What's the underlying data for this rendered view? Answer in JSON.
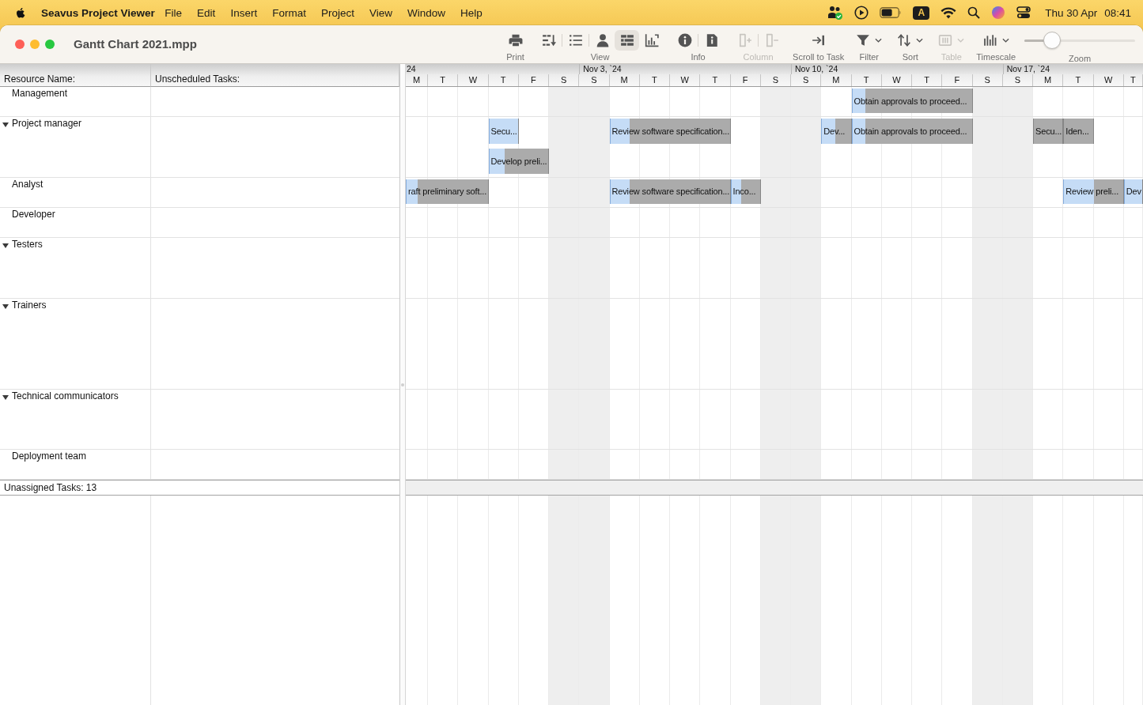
{
  "menu_bar": {
    "app_name": "Seavus Project Viewer",
    "menus": [
      "File",
      "Edit",
      "Insert",
      "Format",
      "Project",
      "View",
      "Window",
      "Help"
    ],
    "input_source": "A",
    "clock": {
      "date": "Thu 30 Apr",
      "time": "08:41"
    }
  },
  "window": {
    "title": "Gantt Chart 2021.mpp"
  },
  "toolbar": {
    "items": [
      {
        "label": "Print",
        "disabled": false,
        "segments": [
          [
            {
              "kind": "print",
              "selected": false,
              "dropdown": false
            }
          ]
        ]
      },
      {
        "label": "View",
        "disabled": false,
        "segments": [
          [
            {
              "kind": "rows",
              "selected": false,
              "dropdown": false
            }
          ],
          [
            {
              "kind": "list",
              "selected": false,
              "dropdown": false
            }
          ],
          [
            {
              "kind": "person",
              "selected": false,
              "dropdown": false
            },
            {
              "kind": "gantt",
              "selected": true,
              "dropdown": false
            },
            {
              "kind": "chart",
              "selected": false,
              "dropdown": false
            }
          ]
        ]
      },
      {
        "label": "Info",
        "disabled": false,
        "segments": [
          [
            {
              "kind": "info",
              "selected": false,
              "dropdown": false
            }
          ],
          [
            {
              "kind": "doc_info",
              "selected": false,
              "dropdown": false
            }
          ]
        ]
      },
      {
        "label": "Column",
        "disabled": true,
        "segments": [
          [
            {
              "kind": "add_column",
              "selected": false,
              "dropdown": false
            }
          ],
          [
            {
              "kind": "remove_column",
              "selected": false,
              "dropdown": false
            }
          ]
        ]
      },
      {
        "label": "Scroll to Task",
        "disabled": false,
        "segments": [
          [
            {
              "kind": "scroll_to",
              "selected": false,
              "dropdown": false
            }
          ]
        ]
      },
      {
        "label": "Filter",
        "disabled": false,
        "segments": [
          [
            {
              "kind": "filter",
              "selected": false,
              "dropdown": true
            }
          ]
        ]
      },
      {
        "label": "Sort",
        "disabled": false,
        "segments": [
          [
            {
              "kind": "sort",
              "selected": false,
              "dropdown": true
            }
          ]
        ]
      },
      {
        "label": "Table",
        "disabled": true,
        "segments": [
          [
            {
              "kind": "table",
              "selected": false,
              "dropdown": true
            }
          ]
        ]
      },
      {
        "label": "Timescale",
        "disabled": false,
        "segments": [
          [
            {
              "kind": "timescale",
              "selected": false,
              "dropdown": true
            }
          ]
        ]
      }
    ],
    "zoom": {
      "label": "Zoom",
      "level": 0.2
    }
  },
  "resource_table": {
    "columns": [
      "Resource Name:",
      "Unscheduled Tasks:"
    ],
    "rows": [
      {
        "name": "Management",
        "lanes": [
          {
            "kind": "bars",
            "slots": [
              {
                "kind": "gap"
              },
              {
                "kind": "gap"
              },
              {
                "kind": "gap"
              },
              {
                "kind": "gap"
              },
              {
                "kind": "gap"
              },
              {
                "kind": "gap"
              },
              {
                "kind": "gap"
              },
              {
                "kind": "gap"
              },
              {
                "kind": "gap"
              },
              {
                "kind": "gap"
              },
              {
                "kind": "gap"
              },
              {
                "kind": "gap"
              },
              {
                "kind": "gap"
              },
              {
                "kind": "gap"
              },
              {
                "kind": "gap"
              },
              {
                "kind": "bar",
                "label": "Obtain approvals to proceed...",
                "level": 0.11
              },
              {
                "kind": "more"
              },
              {
                "kind": "more"
              },
              {
                "kind": "more"
              },
              {
                "kind": "gap"
              },
              {
                "kind": "gap"
              },
              {
                "kind": "gap"
              },
              {
                "kind": "gap"
              },
              {
                "kind": "gap"
              },
              {
                "kind": "gap"
              }
            ]
          }
        ]
      },
      {
        "name": "Project manager",
        "expanded": true,
        "lanes": [
          {
            "kind": "bars",
            "slots": [
              {
                "kind": "gap"
              },
              {
                "kind": "gap"
              },
              {
                "kind": "gap"
              },
              {
                "kind": "bar",
                "label": "Secu...",
                "level": 1
              },
              {
                "kind": "gap"
              },
              {
                "kind": "gap"
              },
              {
                "kind": "gap"
              },
              {
                "kind": "bar",
                "label": "Review software specification...",
                "level": 0.16
              },
              {
                "kind": "more"
              },
              {
                "kind": "more"
              },
              {
                "kind": "more"
              },
              {
                "kind": "gap"
              },
              {
                "kind": "gap"
              },
              {
                "kind": "gap"
              },
              {
                "kind": "bar",
                "label": "Dev...",
                "level": 0.47
              },
              {
                "kind": "bar",
                "label": "Obtain approvals to proceed...",
                "level": 0.11
              },
              {
                "kind": "more"
              },
              {
                "kind": "more"
              },
              {
                "kind": "more"
              },
              {
                "kind": "gap"
              },
              {
                "kind": "gap"
              },
              {
                "kind": "bar",
                "label": "Secu..."
              },
              {
                "kind": "bar",
                "label": "Iden..."
              },
              {
                "kind": "gap"
              },
              {
                "kind": "gap"
              }
            ]
          },
          {
            "kind": "bars",
            "slots": [
              {
                "kind": "gap"
              },
              {
                "kind": "gap"
              },
              {
                "kind": "gap"
              },
              {
                "kind": "bar",
                "label": "Develop preli...",
                "level": 0.26
              },
              {
                "kind": "more"
              },
              {
                "kind": "gap"
              },
              {
                "kind": "gap"
              },
              {
                "kind": "gap"
              },
              {
                "kind": "gap"
              },
              {
                "kind": "gap"
              },
              {
                "kind": "gap"
              },
              {
                "kind": "gap"
              },
              {
                "kind": "gap"
              },
              {
                "kind": "gap"
              },
              {
                "kind": "gap"
              },
              {
                "kind": "gap"
              },
              {
                "kind": "gap"
              },
              {
                "kind": "gap"
              },
              {
                "kind": "gap"
              },
              {
                "kind": "gap"
              },
              {
                "kind": "gap"
              },
              {
                "kind": "gap"
              },
              {
                "kind": "gap"
              },
              {
                "kind": "gap"
              },
              {
                "kind": "gap"
              }
            ]
          }
        ]
      },
      {
        "name": "Analyst",
        "lanes": [
          {
            "kind": "bars",
            "slots": [
              {
                "kind": "bar",
                "label": "raft preliminary soft...",
                "level": 0.14
              },
              {
                "kind": "more"
              },
              {
                "kind": "more"
              },
              {
                "kind": "gap"
              },
              {
                "kind": "gap"
              },
              {
                "kind": "gap"
              },
              {
                "kind": "gap"
              },
              {
                "kind": "bar",
                "label": "Review software specification...",
                "level": 0.16
              },
              {
                "kind": "more"
              },
              {
                "kind": "more"
              },
              {
                "kind": "more"
              },
              {
                "kind": "bar",
                "label": "Inco...",
                "level": 0.34
              },
              {
                "kind": "gap"
              },
              {
                "kind": "gap"
              },
              {
                "kind": "gap"
              },
              {
                "kind": "gap"
              },
              {
                "kind": "gap"
              },
              {
                "kind": "gap"
              },
              {
                "kind": "gap"
              },
              {
                "kind": "gap"
              },
              {
                "kind": "gap"
              },
              {
                "kind": "gap"
              },
              {
                "kind": "bar",
                "label": "Review preli...",
                "level": 0.5
              },
              {
                "kind": "more"
              },
              {
                "kind": "bar",
                "label": "Dev",
                "level": 1
              }
            ]
          }
        ]
      },
      {
        "name": "Developer",
        "lanes": [
          {
            "kind": "empty"
          }
        ]
      },
      {
        "name": "Testers",
        "expanded": true,
        "lanes": [
          {
            "kind": "empty"
          },
          {
            "kind": "empty"
          }
        ]
      },
      {
        "name": "Trainers",
        "expanded": true,
        "lanes": [
          {
            "kind": "empty"
          },
          {
            "kind": "empty"
          },
          {
            "kind": "empty"
          }
        ]
      },
      {
        "name": "Technical communicators",
        "expanded": true,
        "lanes": [
          {
            "kind": "empty"
          },
          {
            "kind": "empty"
          }
        ]
      },
      {
        "name": "Deployment team",
        "lanes": [
          {
            "kind": "empty"
          }
        ]
      }
    ],
    "footer": "Unassigned Tasks: 13"
  },
  "gantt": {
    "weeks": [
      {
        "label": "24",
        "days": [
          {
            "label": "M",
            "weekend": false
          },
          {
            "label": "T",
            "weekend": false
          },
          {
            "label": "W",
            "weekend": false
          },
          {
            "label": "T",
            "weekend": false
          },
          {
            "label": "F",
            "weekend": false
          },
          {
            "label": "S",
            "weekend": true
          }
        ]
      },
      {
        "label": "Nov 3, `24",
        "days": [
          {
            "label": "S",
            "weekend": true
          },
          {
            "label": "M",
            "weekend": false
          },
          {
            "label": "T",
            "weekend": false
          },
          {
            "label": "W",
            "weekend": false
          },
          {
            "label": "T",
            "weekend": false
          },
          {
            "label": "F",
            "weekend": false
          },
          {
            "label": "S",
            "weekend": true
          }
        ]
      },
      {
        "label": "Nov 10, `24",
        "days": [
          {
            "label": "S",
            "weekend": true
          },
          {
            "label": "M",
            "weekend": false
          },
          {
            "label": "T",
            "weekend": false
          },
          {
            "label": "W",
            "weekend": false
          },
          {
            "label": "T",
            "weekend": false
          },
          {
            "label": "F",
            "weekend": false
          },
          {
            "label": "S",
            "weekend": true
          }
        ]
      },
      {
        "label": "Nov 17, `24",
        "days": [
          {
            "label": "S",
            "weekend": true
          },
          {
            "label": "M",
            "weekend": false
          },
          {
            "label": "T",
            "weekend": false
          },
          {
            "label": "W",
            "weekend": false
          },
          {
            "label": "T",
            "weekend": false
          }
        ]
      }
    ]
  }
}
